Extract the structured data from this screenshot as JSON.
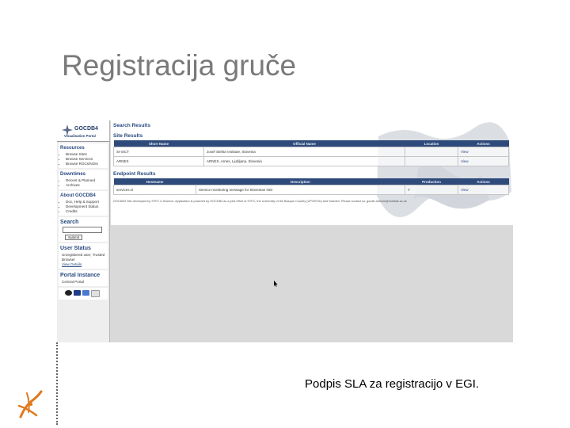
{
  "slide": {
    "title": "Registracija gruče",
    "caption": "Podpis SLA za registracijo v EGI."
  },
  "portal": {
    "brand": "GOCDB4",
    "brand_sub": "Visualisation Portal",
    "sidebar": {
      "resources": {
        "heading": "Resources",
        "items": [
          "Browse Sites",
          "Browse Services",
          "Browse ROCs/NGIs"
        ]
      },
      "downtimes": {
        "heading": "Downtimes",
        "items": [
          "Recent & Planned",
          "Archives"
        ]
      },
      "about": {
        "heading": "About GOCDB4",
        "items": [
          "Doc, Help & Support",
          "Development Status",
          "Credits"
        ]
      },
      "search": {
        "heading": "Search",
        "submit_label": "Submit"
      },
      "user_status": {
        "heading": "User Status",
        "text": "Unregistered user, Trusted Browser",
        "link": "View Details"
      },
      "portal_instance": {
        "heading": "Portal Instance",
        "text": "Central Portal"
      },
      "flag_colors": [
        "#222222",
        "#1f3c88",
        "#4a7ad0",
        "#e0e0e0"
      ]
    },
    "main": {
      "search_results_title": "Search Results",
      "site_results": {
        "title": "Site Results",
        "columns": [
          "Short Name",
          "Official Name",
          "Location",
          "Actions"
        ],
        "rows": [
          [
            "SI-SICT",
            "Josef Stefan Institute, Slovenia",
            "",
            "View"
          ],
          [
            "ARNES",
            "ARNES, Arnes, Ljubljana, Slovenia",
            "",
            "View"
          ]
        ]
      },
      "endpoint_results": {
        "title": "Endpoint Results",
        "columns": [
          "Hostname",
          "Description",
          "Production",
          "Actions"
        ],
        "rows": [
          [
            "services.si",
            "Service monitoring message for Slovenian NGI",
            "Y",
            "View"
          ]
        ]
      },
      "footer": "GOCDB4 Site developed by STFC e-Science. Application is powered by GOCDB4 as a joint effort of STFC, the University of the Basque Country (UPV/EHU) and Sweden. Please contact us: gocdb-admins@mailtalk.ac.uk"
    }
  }
}
